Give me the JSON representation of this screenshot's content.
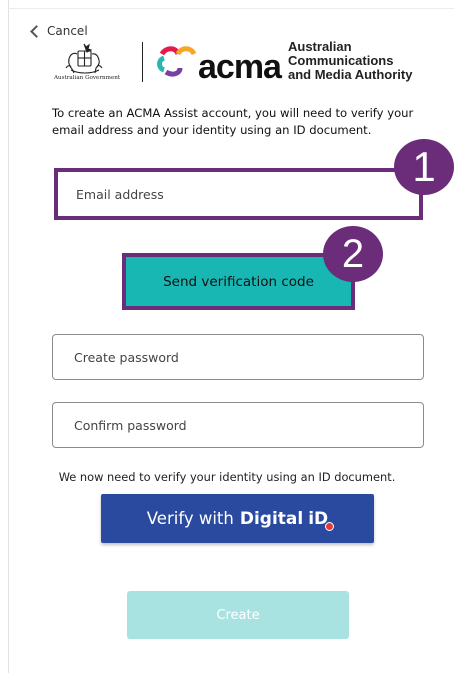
{
  "nav": {
    "cancel_label": "Cancel"
  },
  "branding": {
    "government_caption": "Australian Government",
    "acma_wordmark": "acma",
    "acma_full_name_line1": "Australian",
    "acma_full_name_line2": "Communications",
    "acma_full_name_line3": "and Media Authority",
    "acma_loop_colors": [
      "#e6194b",
      "#f5a623",
      "#2bb5b0",
      "#7b3fa0"
    ]
  },
  "intro_text": "To create an ACMA Assist account, you will need to verify your email address and your identity using an ID document.",
  "form": {
    "email_placeholder": "Email address",
    "send_code_label": "Send verification code",
    "create_password_placeholder": "Create password",
    "confirm_password_placeholder": "Confirm password"
  },
  "annotations": {
    "step1": "1",
    "step2": "2",
    "highlight_color": "#6b2c7a"
  },
  "identity": {
    "note": "We now need to verify your identity using an ID document.",
    "verify_prefix": "Verify with",
    "brand_word": "Digital",
    "brand_id": "iD",
    "button_color": "#2a4aa0"
  },
  "create_label": "Create",
  "colors": {
    "accent_teal": "#19b7b4",
    "disabled_teal": "#a8e3e2"
  }
}
